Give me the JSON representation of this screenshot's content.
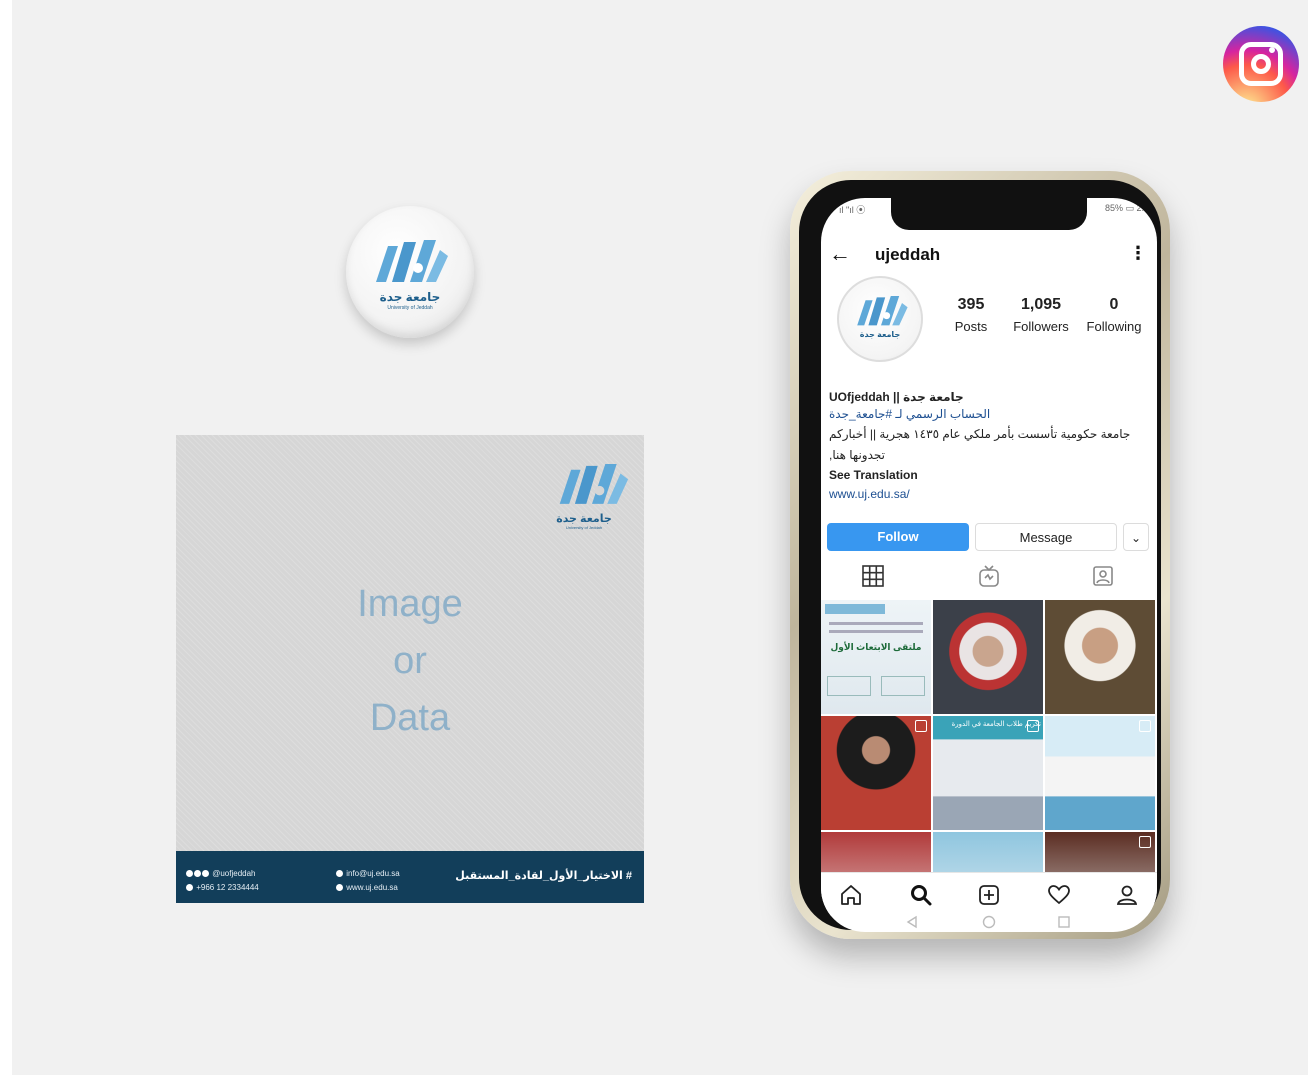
{
  "colors": {
    "background": "#f1f1f1",
    "uni_blue": "#5ea8d8",
    "uni_dark": "#123e5a",
    "follow_blue": "#3897f0"
  },
  "instagram_badge": {
    "icon": "instagram-icon"
  },
  "logo": {
    "name_ar": "جامعة جدة",
    "name_en": "University of Jeddah"
  },
  "post": {
    "placeholder_lines": [
      "Image",
      "or",
      "Data"
    ],
    "footer": {
      "handle": "@uofjeddah",
      "phone": "+966 12 2334444",
      "email": "info@uj.edu.sa",
      "website": "www.uj.edu.sa",
      "slogan": "# الاختيار_الأول_لقادة_المستقبل"
    }
  },
  "phone": {
    "status_left": "ıl \"ıl ⦿",
    "status_right": "85% ▭ 2:0",
    "profile": {
      "username": "ujeddah",
      "stats": [
        {
          "value": "395",
          "label": "Posts"
        },
        {
          "value": "1,095",
          "label": "Followers"
        },
        {
          "value": "0",
          "label": "Following"
        }
      ],
      "bio": {
        "name_line": "UOfjeddah || جامعة جدة",
        "line2": "الحساب الرسمي لـ #جامعة_جدة",
        "line3": "جامعة حكومية تأسست بأمر ملكي عام ١٤٣٥ هجرية || أخباركم",
        "line4": "تجدونها هنا,",
        "see_translation": "See Translation",
        "website": "www.uj.edu.sa/"
      },
      "buttons": {
        "follow": "Follow",
        "message": "Message",
        "more": "⌄"
      },
      "grid_texts": {
        "post1_title": "ملتقى الابتعاث الأول",
        "post4_caption": "تكريم طلاب الجامعة في الدورة"
      }
    }
  }
}
